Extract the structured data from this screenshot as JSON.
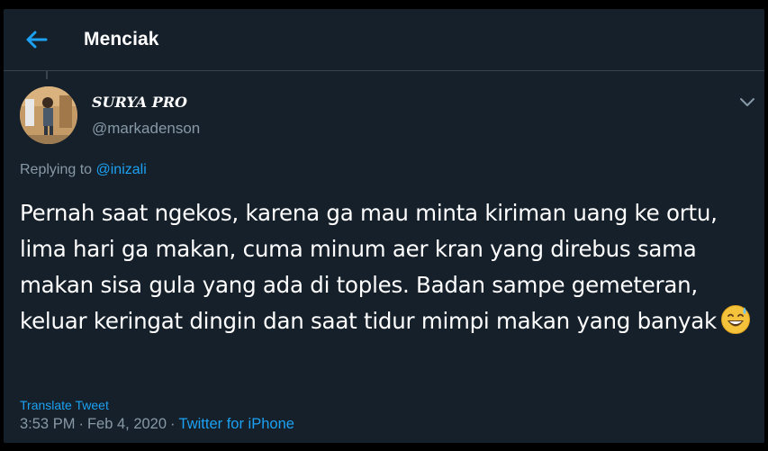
{
  "header": {
    "title": "Menciak",
    "back_icon": "back-arrow-icon"
  },
  "tweet": {
    "display_name": "SURYA PRO",
    "handle": "@markadenson",
    "replying_to_label": "Replying to",
    "replying_to_user": "@inizali",
    "text": "Pernah saat ngekos, karena ga mau minta kiriman uang ke ortu, lima hari ga makan, cuma minum aer kran yang direbus sama makan sisa gula yang ada di toples. Badan sampe gemeteran,  keluar keringat dingin dan saat tidur mimpi makan yang banyak",
    "emoji": "grinning-face-with-sweat-icon",
    "translate_label": "Translate Tweet",
    "time": "3:53 PM",
    "date": "Feb 4, 2020",
    "separator": "·",
    "source": "Twitter for iPhone"
  },
  "colors": {
    "background": "#15202b",
    "accent": "#1da1f2",
    "secondary_text": "#8899a6",
    "divider": "#38444d"
  }
}
